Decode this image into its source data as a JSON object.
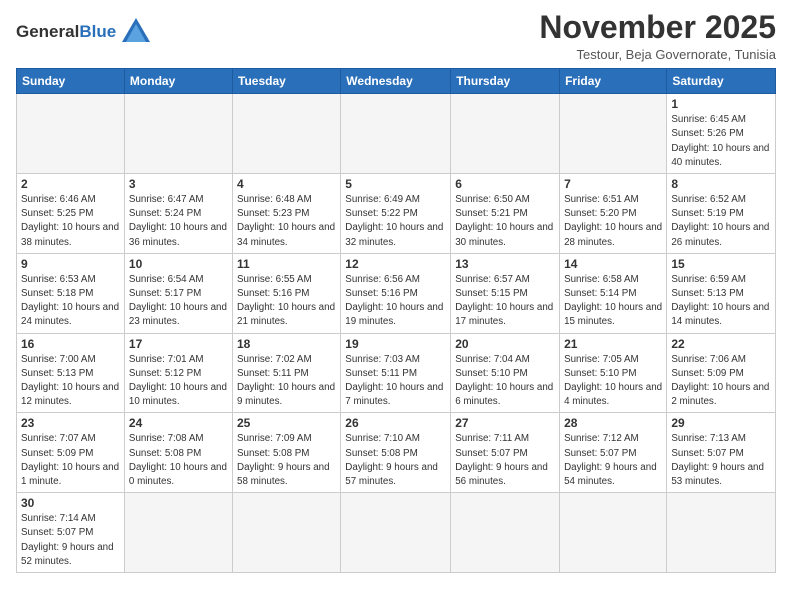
{
  "logo": {
    "text_general": "General",
    "text_blue": "Blue"
  },
  "header": {
    "month_year": "November 2025",
    "subtitle": "Testour, Beja Governorate, Tunisia"
  },
  "weekdays": [
    "Sunday",
    "Monday",
    "Tuesday",
    "Wednesday",
    "Thursday",
    "Friday",
    "Saturday"
  ],
  "weeks": [
    [
      {
        "day": "",
        "info": ""
      },
      {
        "day": "",
        "info": ""
      },
      {
        "day": "",
        "info": ""
      },
      {
        "day": "",
        "info": ""
      },
      {
        "day": "",
        "info": ""
      },
      {
        "day": "",
        "info": ""
      },
      {
        "day": "1",
        "info": "Sunrise: 6:45 AM\nSunset: 5:26 PM\nDaylight: 10 hours and 40 minutes."
      }
    ],
    [
      {
        "day": "2",
        "info": "Sunrise: 6:46 AM\nSunset: 5:25 PM\nDaylight: 10 hours and 38 minutes."
      },
      {
        "day": "3",
        "info": "Sunrise: 6:47 AM\nSunset: 5:24 PM\nDaylight: 10 hours and 36 minutes."
      },
      {
        "day": "4",
        "info": "Sunrise: 6:48 AM\nSunset: 5:23 PM\nDaylight: 10 hours and 34 minutes."
      },
      {
        "day": "5",
        "info": "Sunrise: 6:49 AM\nSunset: 5:22 PM\nDaylight: 10 hours and 32 minutes."
      },
      {
        "day": "6",
        "info": "Sunrise: 6:50 AM\nSunset: 5:21 PM\nDaylight: 10 hours and 30 minutes."
      },
      {
        "day": "7",
        "info": "Sunrise: 6:51 AM\nSunset: 5:20 PM\nDaylight: 10 hours and 28 minutes."
      },
      {
        "day": "8",
        "info": "Sunrise: 6:52 AM\nSunset: 5:19 PM\nDaylight: 10 hours and 26 minutes."
      }
    ],
    [
      {
        "day": "9",
        "info": "Sunrise: 6:53 AM\nSunset: 5:18 PM\nDaylight: 10 hours and 24 minutes."
      },
      {
        "day": "10",
        "info": "Sunrise: 6:54 AM\nSunset: 5:17 PM\nDaylight: 10 hours and 23 minutes."
      },
      {
        "day": "11",
        "info": "Sunrise: 6:55 AM\nSunset: 5:16 PM\nDaylight: 10 hours and 21 minutes."
      },
      {
        "day": "12",
        "info": "Sunrise: 6:56 AM\nSunset: 5:16 PM\nDaylight: 10 hours and 19 minutes."
      },
      {
        "day": "13",
        "info": "Sunrise: 6:57 AM\nSunset: 5:15 PM\nDaylight: 10 hours and 17 minutes."
      },
      {
        "day": "14",
        "info": "Sunrise: 6:58 AM\nSunset: 5:14 PM\nDaylight: 10 hours and 15 minutes."
      },
      {
        "day": "15",
        "info": "Sunrise: 6:59 AM\nSunset: 5:13 PM\nDaylight: 10 hours and 14 minutes."
      }
    ],
    [
      {
        "day": "16",
        "info": "Sunrise: 7:00 AM\nSunset: 5:13 PM\nDaylight: 10 hours and 12 minutes."
      },
      {
        "day": "17",
        "info": "Sunrise: 7:01 AM\nSunset: 5:12 PM\nDaylight: 10 hours and 10 minutes."
      },
      {
        "day": "18",
        "info": "Sunrise: 7:02 AM\nSunset: 5:11 PM\nDaylight: 10 hours and 9 minutes."
      },
      {
        "day": "19",
        "info": "Sunrise: 7:03 AM\nSunset: 5:11 PM\nDaylight: 10 hours and 7 minutes."
      },
      {
        "day": "20",
        "info": "Sunrise: 7:04 AM\nSunset: 5:10 PM\nDaylight: 10 hours and 6 minutes."
      },
      {
        "day": "21",
        "info": "Sunrise: 7:05 AM\nSunset: 5:10 PM\nDaylight: 10 hours and 4 minutes."
      },
      {
        "day": "22",
        "info": "Sunrise: 7:06 AM\nSunset: 5:09 PM\nDaylight: 10 hours and 2 minutes."
      }
    ],
    [
      {
        "day": "23",
        "info": "Sunrise: 7:07 AM\nSunset: 5:09 PM\nDaylight: 10 hours and 1 minute."
      },
      {
        "day": "24",
        "info": "Sunrise: 7:08 AM\nSunset: 5:08 PM\nDaylight: 10 hours and 0 minutes."
      },
      {
        "day": "25",
        "info": "Sunrise: 7:09 AM\nSunset: 5:08 PM\nDaylight: 9 hours and 58 minutes."
      },
      {
        "day": "26",
        "info": "Sunrise: 7:10 AM\nSunset: 5:08 PM\nDaylight: 9 hours and 57 minutes."
      },
      {
        "day": "27",
        "info": "Sunrise: 7:11 AM\nSunset: 5:07 PM\nDaylight: 9 hours and 56 minutes."
      },
      {
        "day": "28",
        "info": "Sunrise: 7:12 AM\nSunset: 5:07 PM\nDaylight: 9 hours and 54 minutes."
      },
      {
        "day": "29",
        "info": "Sunrise: 7:13 AM\nSunset: 5:07 PM\nDaylight: 9 hours and 53 minutes."
      }
    ],
    [
      {
        "day": "30",
        "info": "Sunrise: 7:14 AM\nSunset: 5:07 PM\nDaylight: 9 hours and 52 minutes."
      },
      {
        "day": "",
        "info": ""
      },
      {
        "day": "",
        "info": ""
      },
      {
        "day": "",
        "info": ""
      },
      {
        "day": "",
        "info": ""
      },
      {
        "day": "",
        "info": ""
      },
      {
        "day": "",
        "info": ""
      }
    ]
  ]
}
